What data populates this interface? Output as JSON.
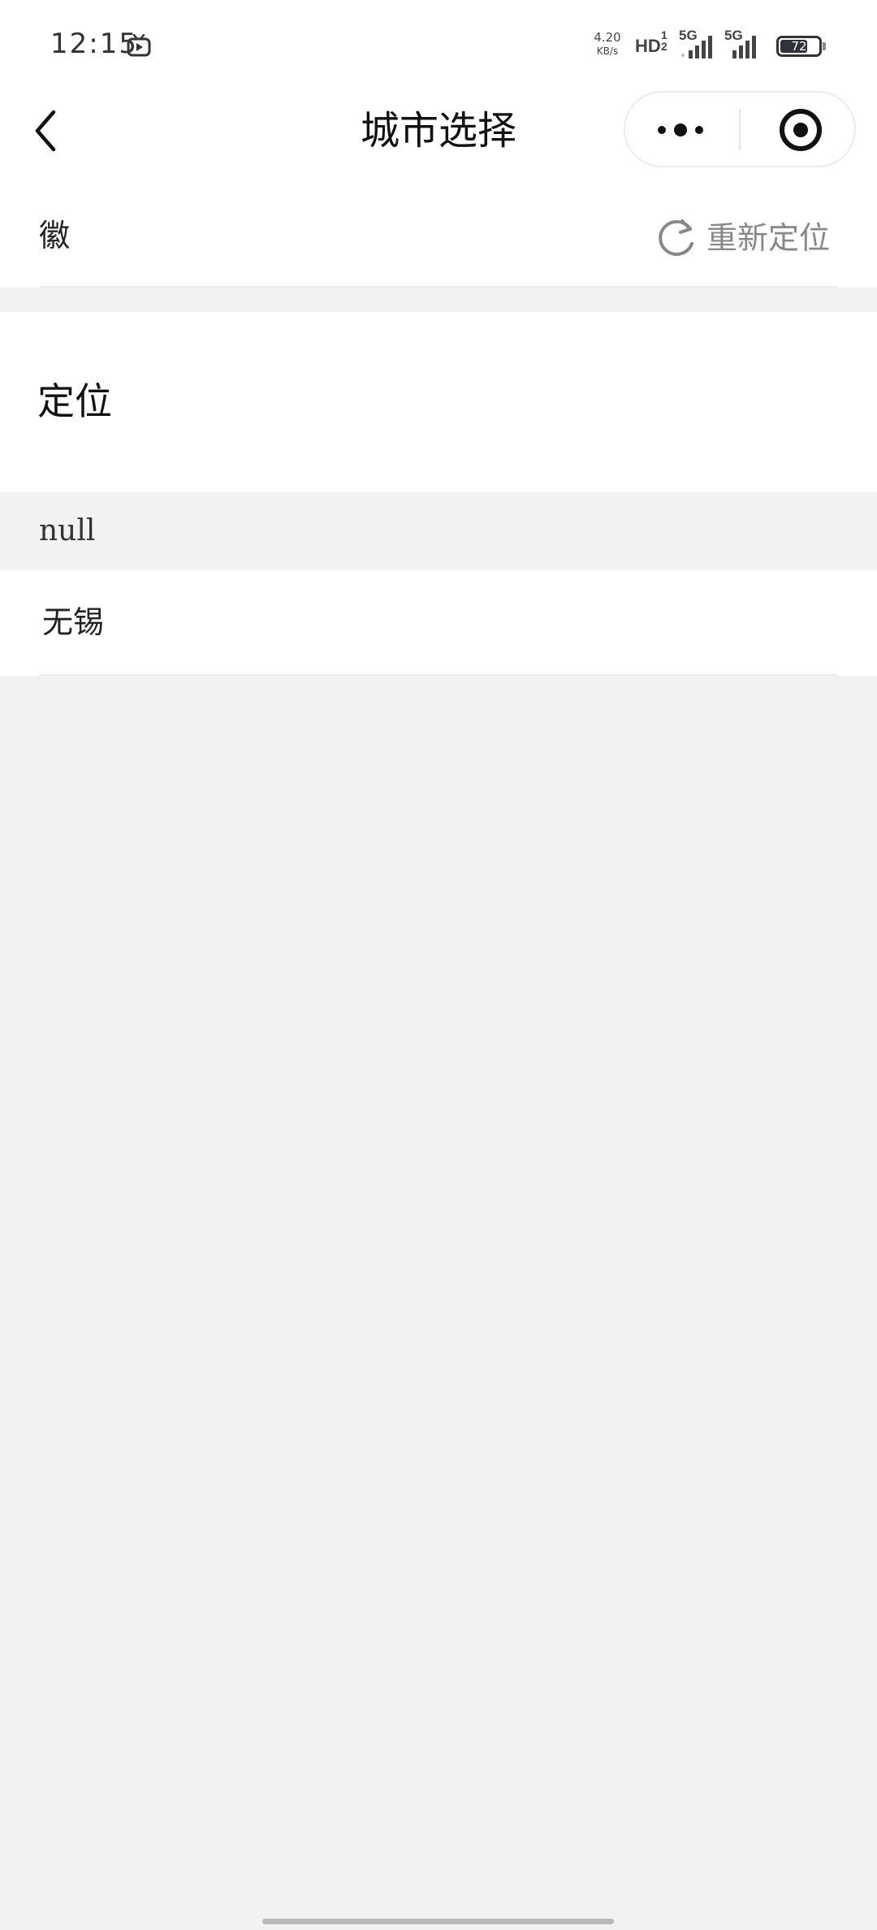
{
  "status_bar": {
    "time": "12:15",
    "app_icon": "tv-icon",
    "net_speed_value": "4.20",
    "net_speed_unit": "KB/s",
    "hd_label": "HD",
    "hd_sub": "1 2",
    "sim1_label": "5G",
    "sim2_label": "5G",
    "battery": "72",
    "battery_level": 0.72,
    "icons": [
      "signal-icon",
      "signal-icon",
      "battery-icon"
    ]
  },
  "nav": {
    "title": "城市选择",
    "back_icon": "chevron-left-icon",
    "more_icon": "more-dots-icon",
    "close_icon": "target-icon"
  },
  "current": {
    "city": "徽",
    "relocate_label": "重新定位",
    "relocate_icon": "refresh-icon"
  },
  "location_section": {
    "title": "定位",
    "group_label": "null",
    "cities": [
      "无锡"
    ]
  },
  "colors": {
    "background": "#f2f2f2",
    "card": "#ffffff",
    "muted_text": "#888888",
    "text": "#1a1a1a"
  }
}
